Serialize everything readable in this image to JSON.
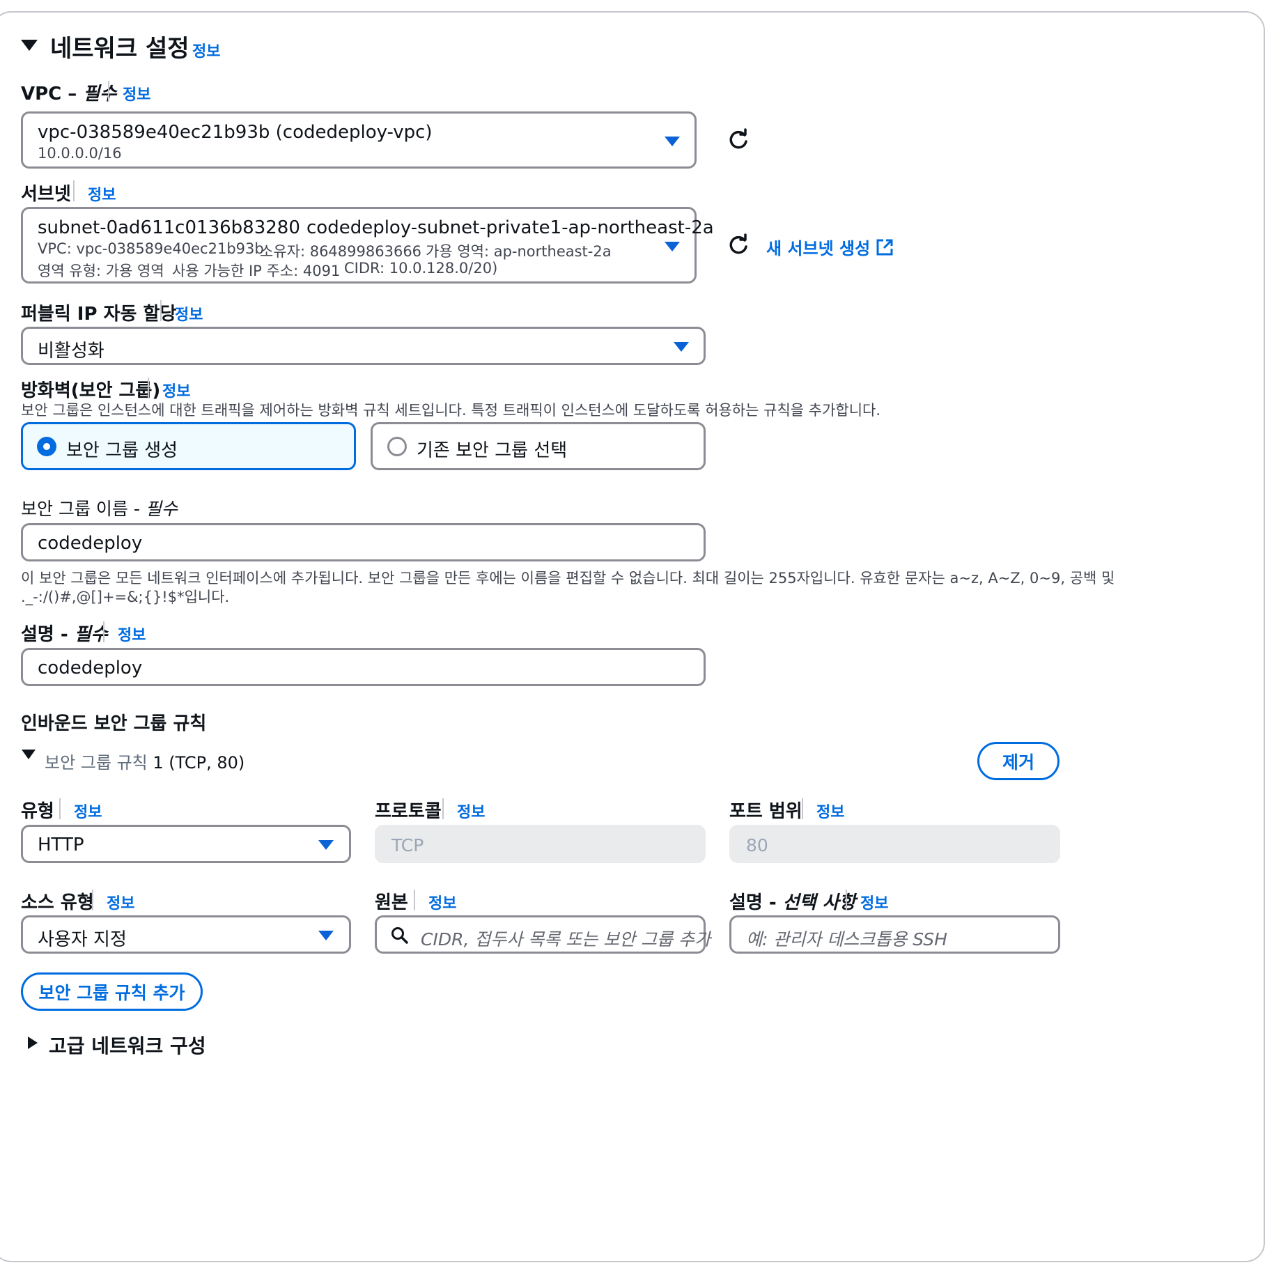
{
  "section": {
    "title": "네트워크 설정",
    "info": "정보"
  },
  "vpc": {
    "label": "VPC –",
    "required": "필수",
    "info": "정보",
    "value": "vpc-038589e40ec21b93b (codedeploy-vpc)",
    "cidr": "10.0.0.0/16"
  },
  "subnet": {
    "label": "서브넷",
    "info": "정보",
    "id": "subnet-0ad611c0136b83280",
    "name": "codedeploy-subnet-private1-ap-northeast-2a",
    "vpc_line": "VPC: vpc-038589e40ec21b93b",
    "owner": "소유자: 864899863666",
    "az": "가용 영역: ap-northeast-2a",
    "zone_type": "영역 유형: 가용 영역",
    "available_ip": "사용 가능한 IP 주소: 4091",
    "cidr": "CIDR: 10.0.128.0/20)",
    "create_link": "새 서브넷 생성"
  },
  "public_ip": {
    "label": "퍼블릭 IP 자동 할당",
    "info": "정보",
    "value": "비활성화"
  },
  "firewall": {
    "label": "방화벽(보안 그룹)",
    "info": "정보",
    "description": "보안 그룹은 인스턴스에 대한 트래픽을 제어하는 방화벽 규칙 세트입니다. 특정 트래픽이 인스턴스에 도달하도록 허용하는 규칙을 추가합니다.",
    "option_create": "보안 그룹 생성",
    "option_existing": "기존 보안 그룹 선택"
  },
  "sg_name": {
    "label": "보안 그룹 이름 -",
    "required": "필수",
    "value": "codedeploy",
    "help_line1": "이 보안 그룹은 모든 네트워크 인터페이스에 추가됩니다. 보안 그룹을 만든 후에는 이름을 편집할 수 없습니다. 최대 길이는 255자입니다. 유효한 문자는 a~z, A~Z, 0~9, 공백 및",
    "help_line2": "._-:/()#,@[]+=&;{}!$*입니다."
  },
  "description": {
    "label": "설명 -",
    "required": "필수",
    "info": "정보",
    "value": "codedeploy"
  },
  "inbound": {
    "title": "인바운드 보안 그룹 규칙",
    "rule_title": "보안 그룹 규칙",
    "rule_suffix": "1 (TCP, 80)",
    "remove": "제거",
    "type_label": "유형",
    "type_value": "HTTP",
    "protocol_label": "프로토콜",
    "protocol_value": "TCP",
    "port_label": "포트 범위",
    "port_value": "80",
    "source_type_label": "소스 유형",
    "source_type_value": "사용자 지정",
    "source_label": "원본",
    "source_placeholder": "CIDR, 접두사 목록 또는 보안 그룹 추가",
    "desc_label": "설명 -",
    "desc_optional": "선택 사항",
    "desc_placeholder": "예: 관리자 데스크톱용 SSH",
    "info": "정보",
    "add_button": "보안 그룹 규칙 추가"
  },
  "advanced": {
    "title": "고급 네트워크 구성"
  },
  "colors": {
    "link": "#006ce0",
    "border": "#8c8c94",
    "selected_bg": "#f0fbff"
  }
}
